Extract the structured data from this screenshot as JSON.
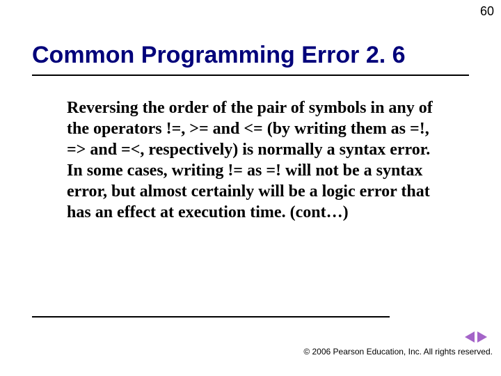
{
  "page_number": "60",
  "title": "Common Programming Error 2. 6",
  "body": "Reversing the order of the pair of symbols in any of the operators !=, >= and <= (by writing them as =!, => and =<, respectively) is normally a syntax error. In some cases, writing != as =! will not be a syntax error, but almost certainly will be a logic error that has an effect at execution time. (cont…)",
  "footer": "© 2006 Pearson Education, Inc.  All rights reserved.",
  "nav": {
    "prev": "previous-slide",
    "next": "next-slide"
  }
}
